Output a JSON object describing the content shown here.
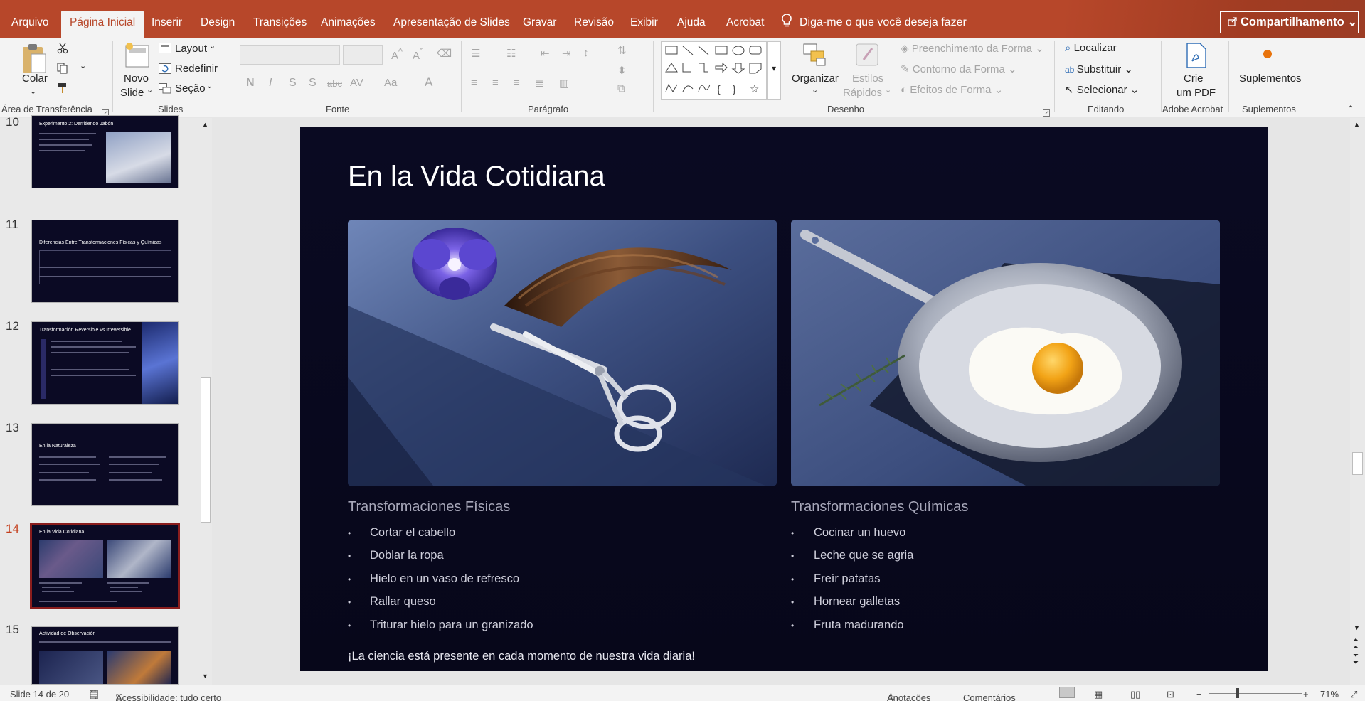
{
  "tabs": [
    "Arquivo",
    "Página Inicial",
    "Inserir",
    "Design",
    "Transições",
    "Animações",
    "Apresentação de Slides",
    "Gravar",
    "Revisão",
    "Exibir",
    "Ajuda",
    "Acrobat"
  ],
  "active_tab": "Página Inicial",
  "tell_me": "Diga-me o que você deseja fazer",
  "share_label": "Compartilhamento",
  "ribbon": {
    "clipboard": {
      "paste": "Colar",
      "group": "Área de Transferência"
    },
    "slides": {
      "new_slide_1": "Novo",
      "new_slide_2": "Slide",
      "layout": "Layout",
      "reset": "Redefinir",
      "section": "Seção",
      "group": "Slides"
    },
    "font": {
      "group": "Fonte"
    },
    "paragraph": {
      "group": "Parágrafo"
    },
    "drawing": {
      "arrange": "Organizar",
      "quick_styles_1": "Estilos",
      "quick_styles_2": "Rápidos",
      "fill": "Preenchimento da Forma",
      "outline": "Contorno da Forma",
      "effects": "Efeitos de Forma",
      "group": "Desenho"
    },
    "editing": {
      "find": "Localizar",
      "replace": "Substituir",
      "select": "Selecionar",
      "group": "Editando"
    },
    "acrobat": {
      "create_1": "Crie",
      "create_2": "um PDF",
      "group": "Adobe Acrobat"
    },
    "addins": {
      "label": "Suplementos",
      "group": "Suplementos"
    }
  },
  "thumbnails": [
    {
      "num": "10",
      "title": "Experimento 2: Derritiendo Jabón"
    },
    {
      "num": "11",
      "title": "Diferencias Entre Transformaciones Físicas y Químicas"
    },
    {
      "num": "12",
      "title": "Transformación Reversible vs Irreversible"
    },
    {
      "num": "13",
      "title": "En la Naturaleza"
    },
    {
      "num": "14",
      "title": "En la Vida Cotidiana"
    },
    {
      "num": "15",
      "title": "Actividad de Observación"
    }
  ],
  "slide": {
    "title": "En la Vida Cotidiana",
    "left_heading": "Transformaciones Físicas",
    "left_items": [
      "Cortar el cabello",
      "Doblar la ropa",
      "Hielo en un vaso de refresco",
      "Rallar queso",
      "Triturar hielo para un granizado"
    ],
    "right_heading": "Transformaciones Químicas",
    "right_items": [
      "Cocinar un huevo",
      "Leche que se agria",
      "Freír patatas",
      "Hornear galletas",
      "Fruta madurando"
    ],
    "footer": "¡La ciencia está presente en cada momento de nuestra vida diaria!"
  },
  "status": {
    "slide": "Slide 14 de 20",
    "accessibility": "Acessibilidade: tudo certo",
    "notes": "Anotações",
    "comments": "Comentários",
    "zoom": "71%"
  }
}
